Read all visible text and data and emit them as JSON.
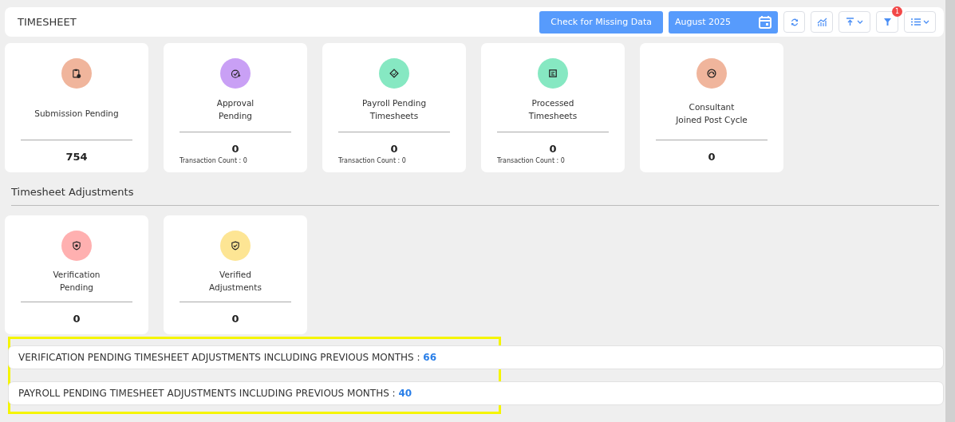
{
  "header": {
    "title": "TIMESHEET",
    "missing_button": "Check for Missing Data",
    "month": "August 2025",
    "filter_badge": "1"
  },
  "summary_cards": [
    {
      "kind": "clipboard",
      "color": "#f0b59c",
      "title": [
        "Submission Pending"
      ],
      "value": "754"
    },
    {
      "kind": "check-plus",
      "color": "#c9a0f5",
      "title": [
        "Approval",
        "Pending"
      ],
      "value": "0",
      "sub": "Transaction Count : 0"
    },
    {
      "kind": "tag",
      "color": "#86e8c2",
      "title": [
        "Payroll Pending",
        "Timesheets"
      ],
      "value": "0",
      "sub": "Transaction Count : 0"
    },
    {
      "kind": "document",
      "color": "#86e8c2",
      "title": [
        "Processed",
        "Timesheets"
      ],
      "value": "0",
      "sub": "Transaction Count : 0"
    },
    {
      "kind": "gauge",
      "color": "#f0b59c",
      "title": [
        "Consultant",
        "Joined Post Cycle"
      ],
      "value": "0"
    }
  ],
  "adjustments_title": "Timesheet Adjustments",
  "adjustment_cards": [
    {
      "kind": "shield",
      "color": "#ffb0b0",
      "title": [
        "Verification",
        "Pending"
      ],
      "value": "0"
    },
    {
      "kind": "shield-check",
      "color": "#fde594",
      "title": [
        "Verified",
        "Adjustments"
      ],
      "value": "0"
    }
  ],
  "totals": [
    {
      "label": "VERIFICATION PENDING TIMESHEET ADJUSTMENTS INCLUDING PREVIOUS MONTHS : ",
      "value": "66"
    },
    {
      "label": "PAYROLL PENDING TIMESHEET ADJUSTMENTS INCLUDING PREVIOUS MONTHS : ",
      "value": "40"
    }
  ]
}
